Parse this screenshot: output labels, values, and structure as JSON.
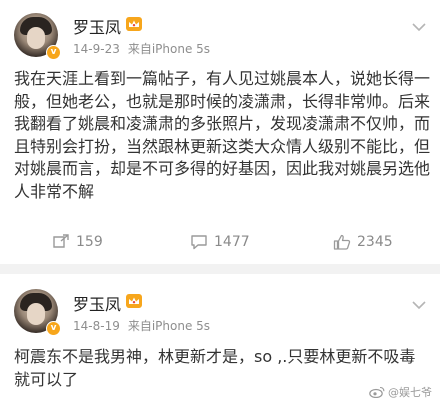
{
  "posts": [
    {
      "author": "罗玉凤",
      "date": "14-9-23",
      "source": "来自iPhone 5s",
      "text": "我在天涯上看到一篇帖子，有人见过姚晨本人，说她长得一般，但她老公，也就是那时候的凌潇肃，长得非常帅。后来我翻看了姚晨和凌潇肃的多张照片，发现凌潇肃不仅帅，而且特别会打扮，当然跟林更新这类大众情人级别不能比，但对姚晨而言，却是不可多得的好基因，因此我对姚晨另选他人非常不解",
      "actions": {
        "reposts": "159",
        "comments": "1477",
        "likes": "2345"
      }
    },
    {
      "author": "罗玉凤",
      "date": "14-8-19",
      "source": "来自iPhone 5s",
      "text": "柯震东不是我男神，林更新才是，so ,.只要林更新不吸毒就可以了"
    }
  ],
  "watermark": "@娱七爷",
  "colors": {
    "accent_orange": "#f7a61c",
    "vip_red": "#e8483b",
    "meta_gray": "#8e8e8e"
  }
}
